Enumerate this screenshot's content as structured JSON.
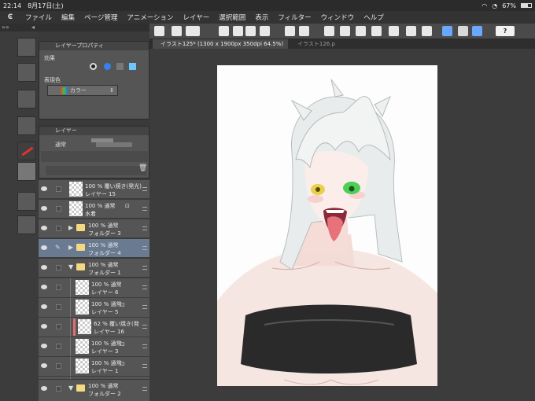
{
  "status": {
    "time": "22:14",
    "date": "8月17日(土)",
    "battery": "67%"
  },
  "menu": [
    "ファイル",
    "編集",
    "ページ管理",
    "アニメーション",
    "レイヤー",
    "選択範囲",
    "表示",
    "フィルター",
    "ウィンドウ",
    "ヘルプ"
  ],
  "help_label": "?",
  "tabs": [
    "イラスト125* (1300 x 1900px 350dpi 64.5%)",
    "イラスト126.p"
  ],
  "prop_panel": {
    "title": "レイヤープロパティ",
    "effect_label": "効果",
    "expression_label": "表現色",
    "expression_value": "カラー"
  },
  "layer_panel": {
    "title": "レイヤー",
    "blend_mode": "通常"
  },
  "layers": [
    {
      "line1": "100 % 覆い焼き(発光)",
      "line2": "レイヤー 15",
      "kind": "layer"
    },
    {
      "line1": "100 % 通常",
      "line2": "水着",
      "kind": "layer"
    },
    {
      "line1": "100 % 通常",
      "line2": "フォルダー 3",
      "kind": "folder"
    },
    {
      "line1": "100 % 通常",
      "line2": "フォルダー 4",
      "kind": "folder"
    },
    {
      "line1": "100 % 通常",
      "line2": "フォルダー 1",
      "kind": "folder-open"
    },
    {
      "line1": "100 % 通常",
      "line2": "レイヤー 6",
      "kind": "sub"
    },
    {
      "line1": "100 % 通常",
      "line2": "レイヤー 5",
      "kind": "sub"
    },
    {
      "line1": "62 % 覆い焼き(発",
      "line2": "レイヤー 16",
      "kind": "sub"
    },
    {
      "line1": "100 % 通常",
      "line2": "レイヤー 3",
      "kind": "sub"
    },
    {
      "line1": "100 % 通常",
      "line2": "レイヤー 1",
      "kind": "sub"
    },
    {
      "line1": "100 % 通常",
      "line2": "フォルダー 2",
      "kind": "folder-open"
    }
  ]
}
